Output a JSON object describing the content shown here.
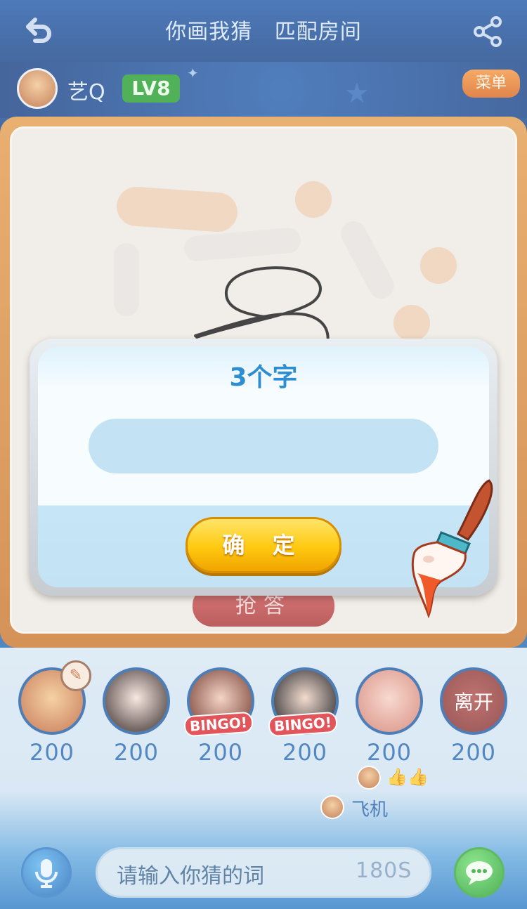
{
  "header": {
    "title": "你画我猜   匹配房间"
  },
  "user": {
    "name": "艺Q",
    "level": "LV8"
  },
  "menu": {
    "label": "菜单"
  },
  "board": {
    "grab_label": "抢答"
  },
  "players": [
    {
      "score": "200",
      "badge": ""
    },
    {
      "score": "200",
      "badge": ""
    },
    {
      "score": "200",
      "badge": "BINGO!"
    },
    {
      "score": "200",
      "badge": "BINGO!"
    },
    {
      "score": "200",
      "badge": ""
    },
    {
      "score": "200",
      "badge": "",
      "overlay": "离开"
    }
  ],
  "events": {
    "gift_text": "飞机"
  },
  "bottom": {
    "placeholder": "请输入你猜的词",
    "timer": "180S"
  },
  "dialog": {
    "title": "3个字",
    "input_value": "",
    "confirm_label": "确 定"
  },
  "colors": {
    "primary_blue": "#1a5aa8",
    "confirm_yellow": "#ffc90f",
    "grab_red": "#c04444",
    "level_green": "#1f9b2a",
    "menu_orange": "#e8782a"
  }
}
